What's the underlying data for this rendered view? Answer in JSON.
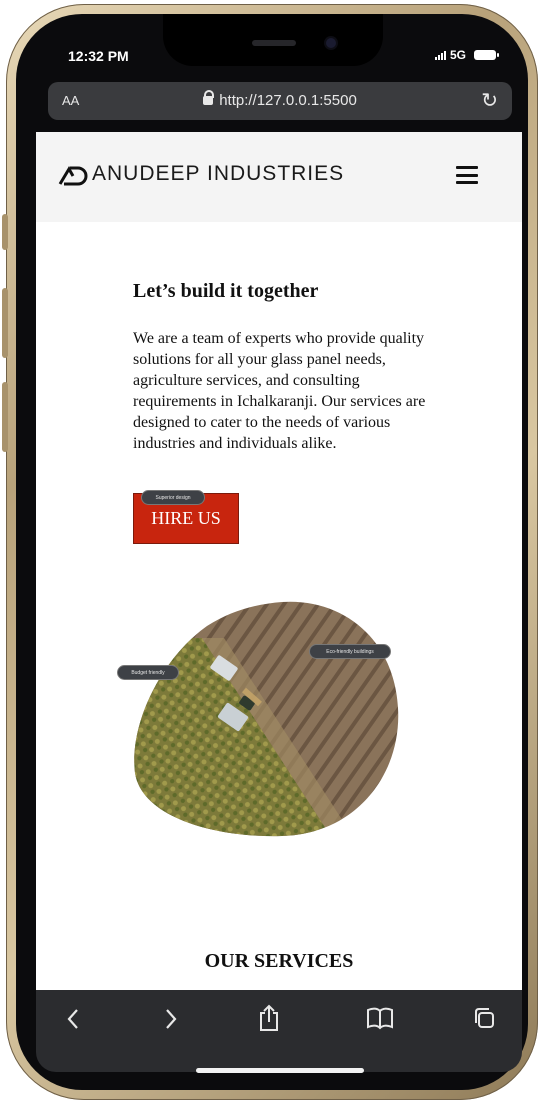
{
  "status_bar": {
    "time": "12:32 PM",
    "network": "5G"
  },
  "browser": {
    "aa_label": "AA",
    "url": "http://127.0.0.1:5500"
  },
  "header": {
    "brand": "ANUDEEP INDUSTRIES"
  },
  "hero": {
    "title": "Let’s build it together",
    "body": "We are a team of experts who provide quality solutions for all your glass panel needs, agriculture services, and consulting requirements in Ichalkaranji. Our services are designed to cater to the needs of various industries and individuals alike.",
    "cta_label": "HIRE US"
  },
  "image_tags": {
    "tag_1": "Superior design",
    "tag_2": "Eco-friendly buildings",
    "tag_3": "Budget friendly"
  },
  "services": {
    "heading": "OUR SERVICES"
  },
  "colors": {
    "cta_background": "#c8250e",
    "header_background": "#f4f4f4",
    "browser_chrome": "#2b2c2f"
  },
  "icons": {
    "back": "chevron-left-icon",
    "forward": "chevron-right-icon",
    "share": "share-icon",
    "bookmarks": "book-icon",
    "tabs": "tabs-icon",
    "menu": "hamburger-icon",
    "reload": "reload-icon",
    "lock": "lock-icon"
  }
}
